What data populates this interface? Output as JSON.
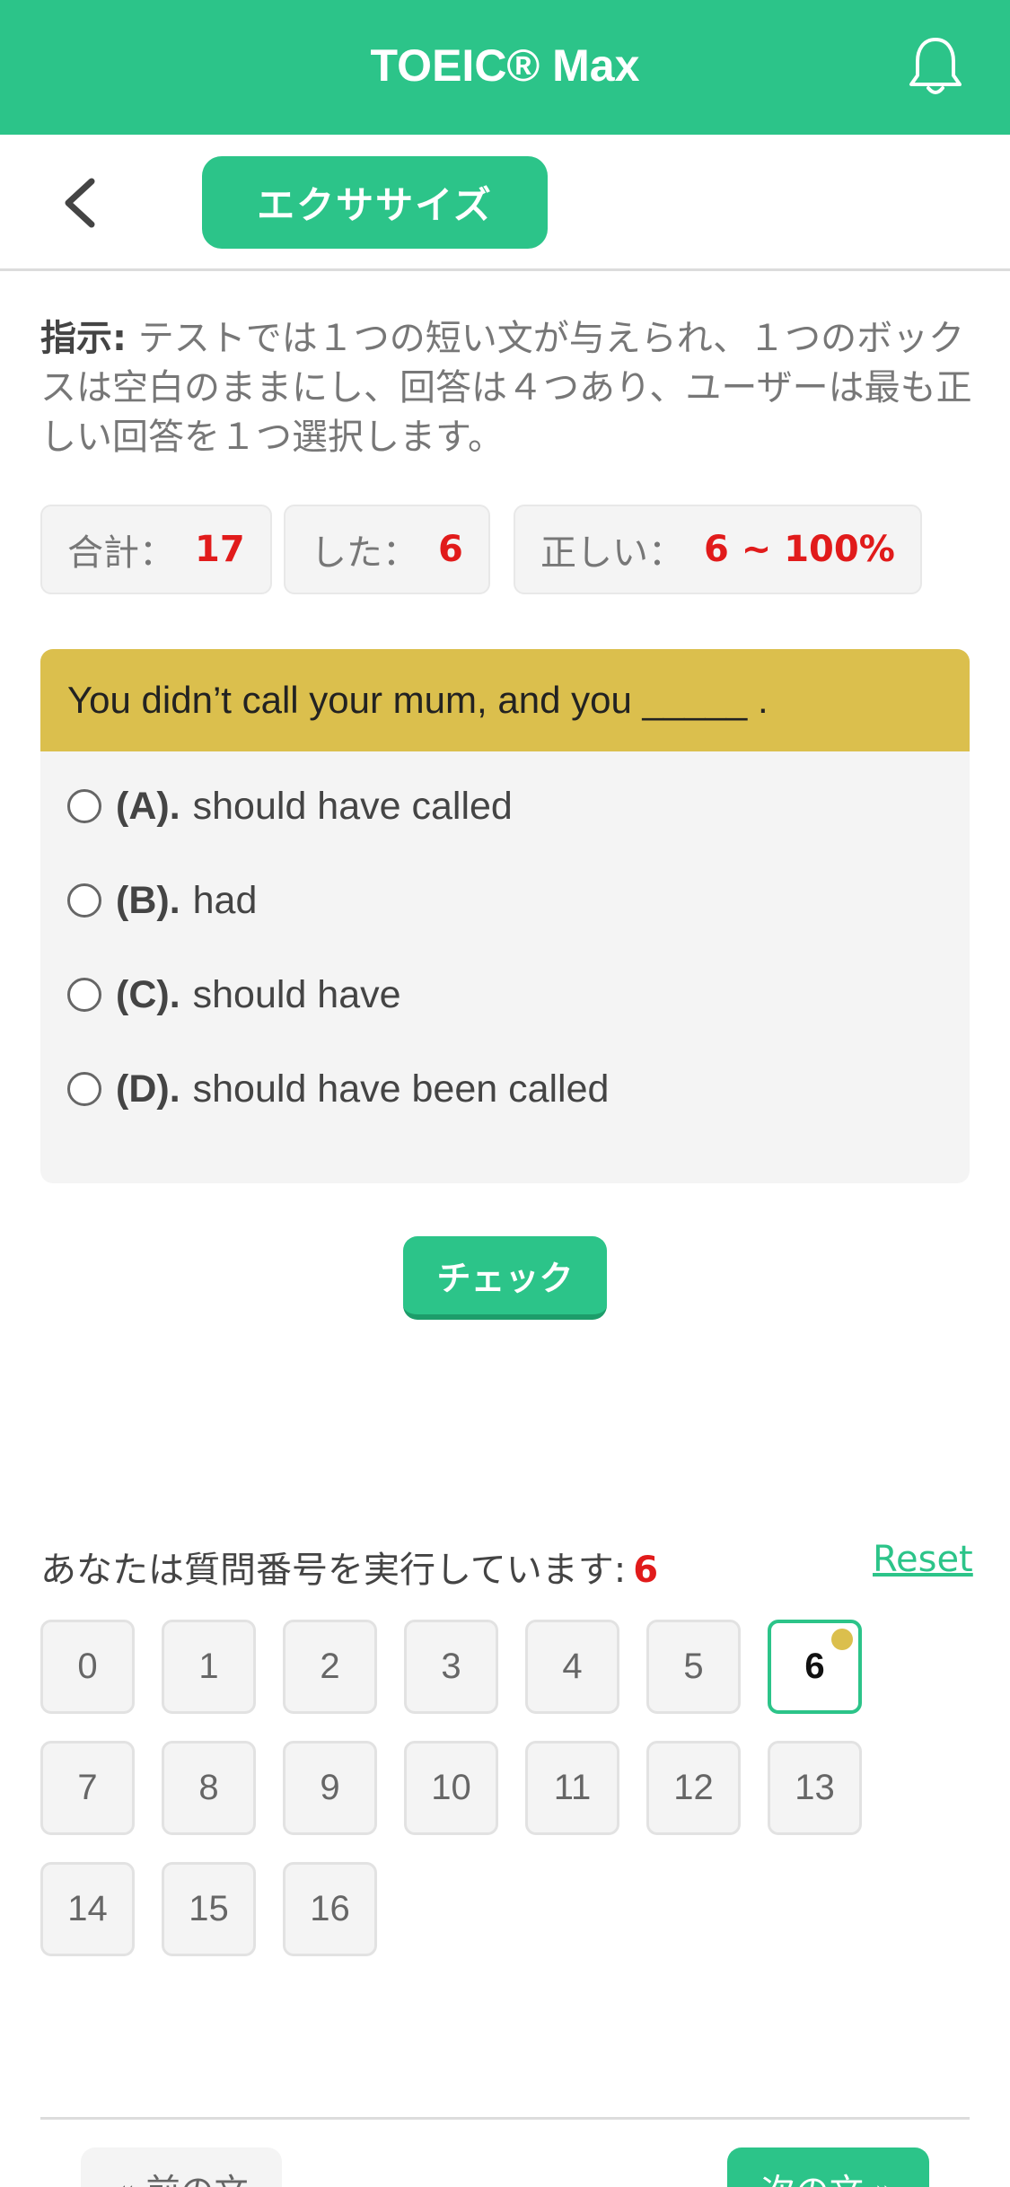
{
  "app": {
    "title": "TOEIC® Max"
  },
  "subbar": {
    "pill_label": "エクササイズ"
  },
  "instructions": {
    "label": "指示:",
    "text": " テストでは１つの短い文が与えられ、１つのボックスは空白のままにし、回答は４つあり、ユーザーは最も正しい回答を１つ選択します。"
  },
  "stats": {
    "total_label": "合計：",
    "total_value": "17",
    "done_label": "した：",
    "done_value": "6",
    "correct_label": "正しい：",
    "correct_value": "6 ~ 100%"
  },
  "question": {
    "text": "You didn’t call your mum, and you _____ .",
    "options": [
      {
        "label": "(A).",
        "text": "should have called"
      },
      {
        "label": "(B).",
        "text": "had"
      },
      {
        "label": "(C).",
        "text": "should have"
      },
      {
        "label": "(D).",
        "text": "should have been called"
      }
    ]
  },
  "check_label": "チェック",
  "progress": {
    "running_label": "あなたは質問番号を実行しています:",
    "current": "6",
    "reset_label": "Reset",
    "numbers": [
      "0",
      "1",
      "2",
      "3",
      "4",
      "5",
      "6",
      "7",
      "8",
      "9",
      "10",
      "11",
      "12",
      "13",
      "14",
      "15",
      "16"
    ]
  },
  "nav": {
    "prev_label": "« 前の文",
    "next_label": "次の文 »"
  },
  "colors": {
    "brand": "#2cc489",
    "question_header": "#dbbf4d",
    "highlight": "#e11b1b"
  },
  "icons": {
    "notification": "bell-icon",
    "back": "chevron-left-icon"
  }
}
